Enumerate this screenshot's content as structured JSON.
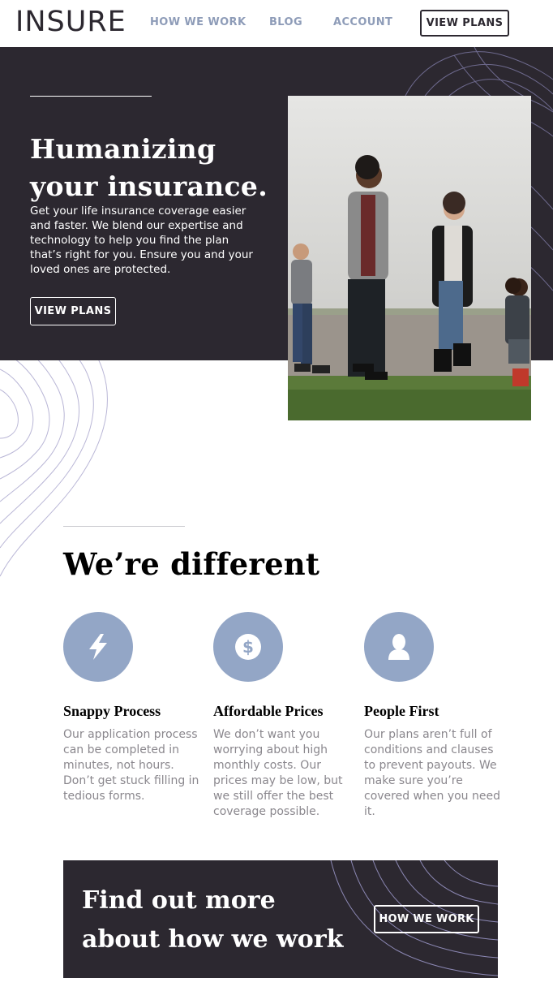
{
  "header": {
    "logo": "INSURE",
    "nav": {
      "how_we_work": "HOW WE WORK",
      "blog": "BLOG",
      "account": "ACCOUNT"
    },
    "cta": "VIEW PLANS"
  },
  "hero": {
    "title_line1": "Humanizing",
    "title_line2": "your insurance.",
    "text": "Get your life insurance coverage easier and faster. We blend our expertise and technology to help you find the plan that’s right for you. Ensure you and your loved ones are protected.",
    "button": "VIEW PLANS"
  },
  "different": {
    "title": "We’re different",
    "features": [
      {
        "icon": "lightning-icon",
        "title": "Snappy Process",
        "text": "Our application process can be completed in minutes, not hours. Don’t get stuck filling in tedious forms."
      },
      {
        "icon": "dollar-icon",
        "title": "Affordable Prices",
        "text": "We don’t want you worrying about high monthly costs. Our prices may be low, but we still offer the best coverage possible."
      },
      {
        "icon": "person-icon",
        "title": "People First",
        "text": "Our plans aren’t full of conditions and clauses to prevent payouts. We make sure you’re covered when you need it."
      }
    ]
  },
  "cta": {
    "title_line1": "Find out more",
    "title_line2": "about how we work",
    "button": "HOW WE WORK"
  },
  "colors": {
    "dark": "#2c2830",
    "accent": "#93a6c6",
    "nav": "#8e9cb8",
    "body_text": "#8a878d"
  }
}
